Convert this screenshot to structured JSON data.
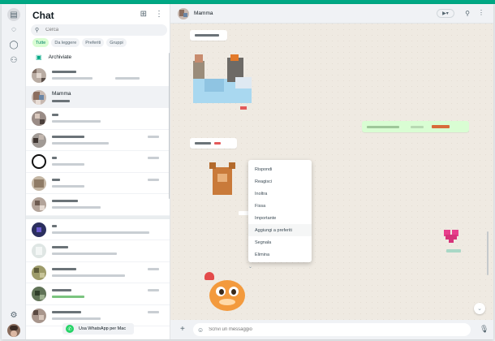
{
  "app": {
    "sidebar_title": "Chat",
    "search_placeholder": "Cerca",
    "filters": [
      "Tutte",
      "Da leggere",
      "Preferiti",
      "Gruppi"
    ],
    "archived_label": "Archiviate",
    "selected_chat_name": "Mamma",
    "mac_button_label": "Usa WhatsApp per Mac"
  },
  "conversation": {
    "contact_name": "Mamma",
    "composer_placeholder": "Scrivi un messaggio"
  },
  "context_menu": {
    "items": [
      "Rispondi",
      "Reagisci",
      "Inoltra",
      "Fissa",
      "Importante",
      "Aggiungi a preferiti",
      "Segnala",
      "Elimina"
    ]
  },
  "icons": {
    "rail": [
      "chats-icon",
      "status-icon",
      "channels-icon",
      "communities-icon",
      "settings-icon",
      "profile-avatar"
    ],
    "header": [
      "new-chat-icon",
      "menu-icon"
    ]
  },
  "colors": {
    "accent": "#00a884",
    "chip_active_bg": "#d9fdd3",
    "outgoing_bubble": "#d9fdd3",
    "wallpaper": "#efeae2"
  }
}
